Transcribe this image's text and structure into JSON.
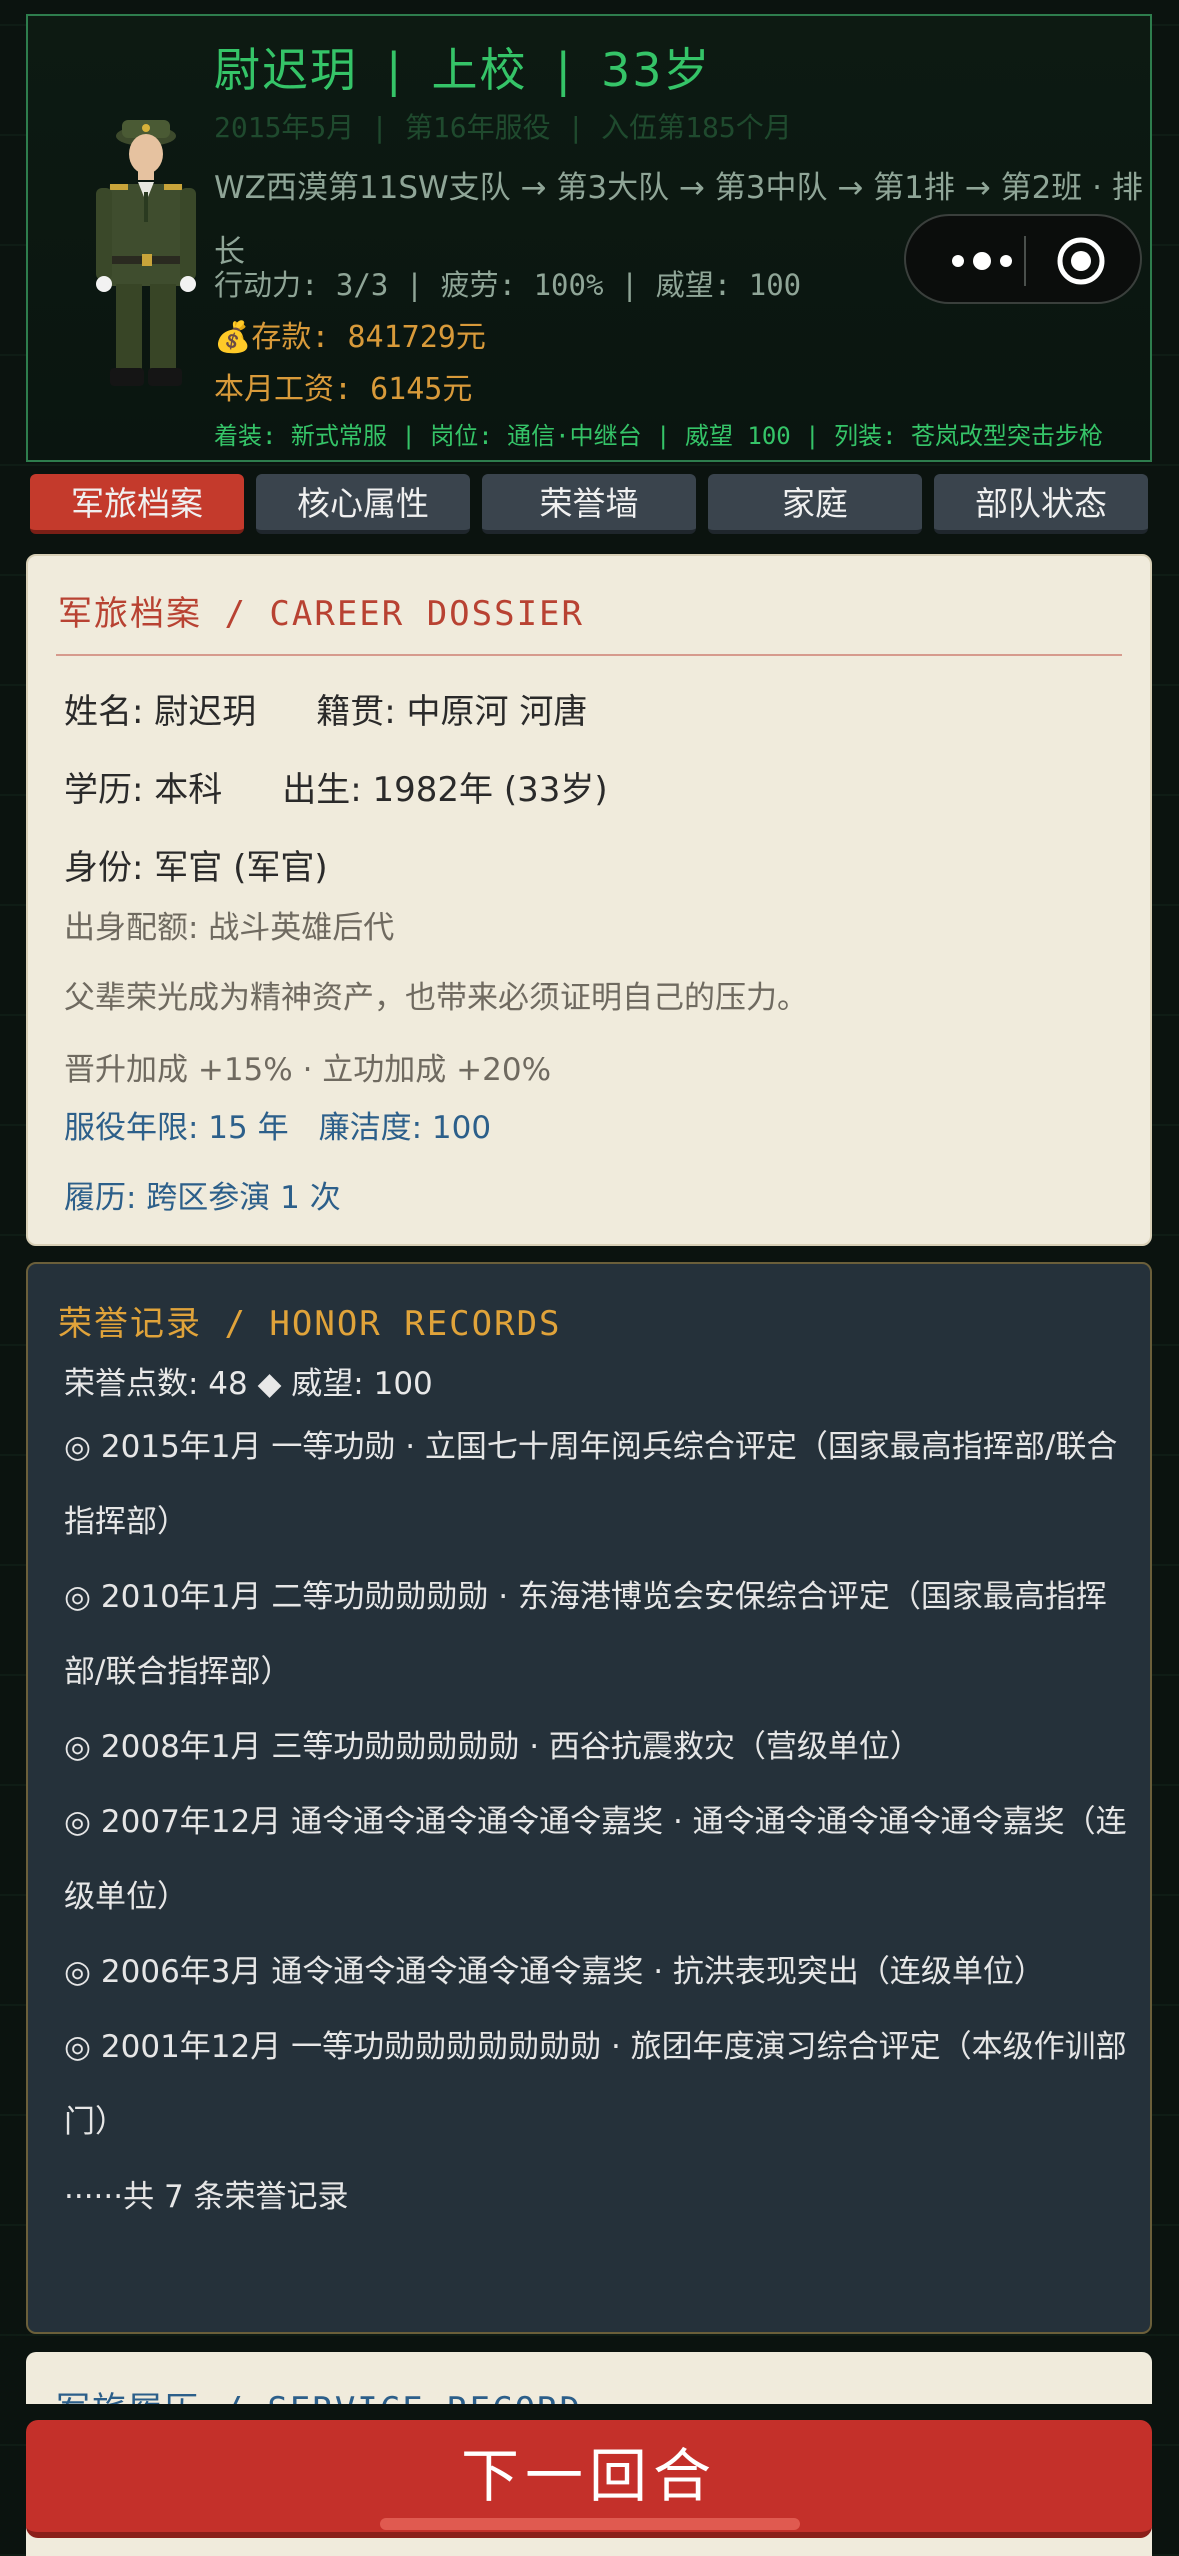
{
  "header": {
    "name": "尉迟玥",
    "rank": "上校",
    "age": "33岁",
    "service_line": "2015年5月  |  第16年服役  |  入伍第185个月",
    "unit_path": "WZ西漠第11SW支队 → 第3大队 → 第3中队 → 第1排 → 第2班 · 排长",
    "stats": "行动力: 3/3  |  疲劳: 100%  |  威望: 100",
    "savings": "💰存款: 841729元",
    "salary": "本月工资: 6145元",
    "equipment": "着装: 新式常服 | 岗位: 通信·中继台 | 威望 100 | 列装: 苍岚改型突击步枪"
  },
  "capsule": {
    "more_icon": "more-dots-icon",
    "close_icon": "target-circle-icon"
  },
  "tabs": [
    {
      "label": "军旅档案",
      "active": true
    },
    {
      "label": "核心属性",
      "active": false
    },
    {
      "label": "荣誉墙",
      "active": false
    },
    {
      "label": "家庭",
      "active": false
    },
    {
      "label": "部队状态",
      "active": false
    }
  ],
  "dossier": {
    "title": "军旅档案 / CAREER DOSSIER",
    "name_field": "姓名: 尉迟玥",
    "origin_field": "籍贯: 中原河 河唐",
    "education_field": "学历: 本科",
    "birth_field": "出生: 1982年 (33岁)",
    "identity_field": "身份: 军官 (军官)",
    "background_field": "出身配额: 战斗英雄后代",
    "background_desc": "父辈荣光成为精神资产，也带来必须证明自己的压力。",
    "bonuses": "晋升加成 +15%  ·  立功加成 +20%",
    "service_years": "服役年限: 15 年",
    "integrity": "廉洁度: 100",
    "history": "履历: 跨区参演 1 次"
  },
  "honor": {
    "title": "荣誉记录 / HONOR RECORDS",
    "points": "荣誉点数: 48 ◆  威望: 100",
    "records": [
      "◎ 2015年1月 一等功勋 · 立国七十周年阅兵综合评定（国家最高指挥部/联合指挥部）",
      "◎ 2010年1月 二等功勋勋勋勋 · 东海港博览会安保综合评定（国家最高指挥部/联合指挥部）",
      "◎ 2008年1月 三等功勋勋勋勋勋 · 西谷抗震救灾（营级单位）",
      "◎ 2007年12月 通令通令通令通令通令嘉奖 · 通令通令通令通令通令嘉奖（连级单位）",
      "◎ 2006年3月 通令通令通令通令通令嘉奖 · 抗洪表现突出（连级单位）",
      "◎ 2001年12月 一等功勋勋勋勋勋勋勋 · 旅团年度演习综合评定（本级作训部门）"
    ],
    "more": "······共 7 条荣誉记录"
  },
  "service": {
    "title": "军旅履历 / SERVICE RECORD"
  },
  "footer": {
    "next_label": "下一回合"
  },
  "colors": {
    "accent_green": "#35c468",
    "accent_red": "#c4302a",
    "gold": "#e0a33a"
  }
}
